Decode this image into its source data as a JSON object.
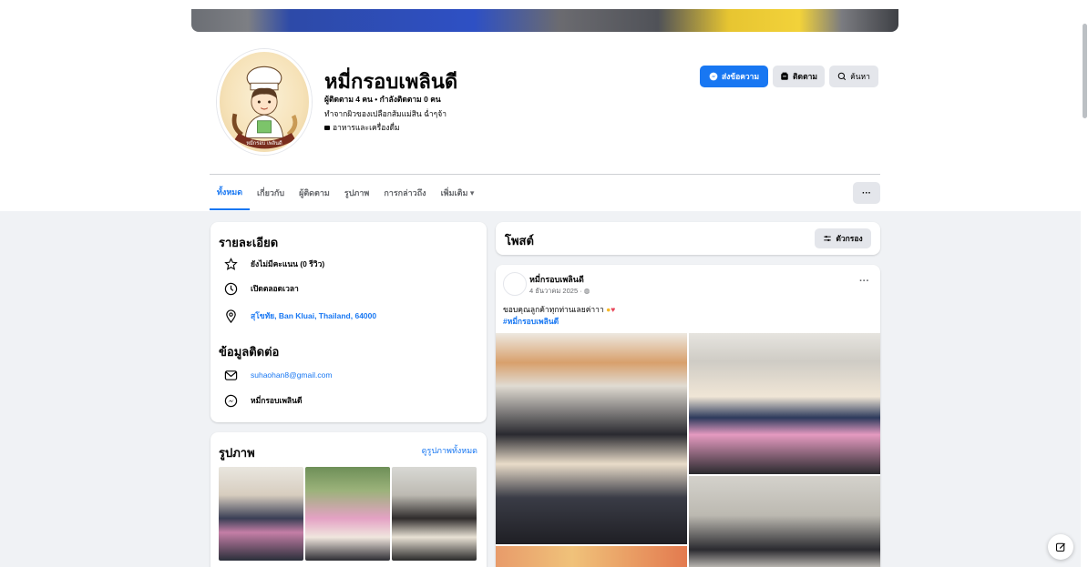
{
  "profile": {
    "name": "หมี่กรอบเพลินดี",
    "followers": "ผู้ติดตาม 4 คน • กำลังติดตาม 0 คน",
    "intro": "ทำจากผิวของเปลือกส้มแม่สิน ฉ่ำๆจ้า",
    "category": "อาหารและเครื่องดื่ม"
  },
  "actions": {
    "message": "ส่งข้อความ",
    "follow": "ติดตาม",
    "search": "ค้นหา"
  },
  "tabs": [
    {
      "label": "ทั้งหมด",
      "active": true
    },
    {
      "label": "เกี่ยวกับ"
    },
    {
      "label": "ผู้ติดตาม"
    },
    {
      "label": "รูปภาพ"
    },
    {
      "label": "การกล่าวถึง"
    },
    {
      "label": "เพิ่มเติม ▾"
    }
  ],
  "tabs_more": "···",
  "details": {
    "heading": "รายละเอียด",
    "rating": "ยังไม่มีคะแนน (0 รีวิว)",
    "hours": "เปิดตลอดเวลา",
    "address_link": "สุโขทัย",
    "address_rest": ", Ban Kluai, Thailand, 64000",
    "contact_heading": "ข้อมูลติดต่อ",
    "email": "suhaohan8@gmail.com",
    "messenger": "หมี่กรอบเพลินดี"
  },
  "photos": {
    "heading": "รูปภาพ",
    "see_all": "ดูรูปภาพทั้งหมด"
  },
  "posts": {
    "heading": "โพสต์",
    "filter": "ตัวกรอง"
  },
  "post": {
    "author": "หมี่กรอบเพลินดี",
    "date": "4 ธันวาคม 2025 · ",
    "more": "···",
    "text": "ขอบคุณลูกค้าทุกท่านเลยค่าาา",
    "hashtag": "#หมี่กรอบเพลินดี"
  },
  "colors": {
    "accent": "#1877f2",
    "background": "#f0f2f5",
    "button_gray": "#e4e6eb"
  },
  "icons": {
    "message": "messenger-icon",
    "follow": "follow-icon",
    "search": "search-icon",
    "rating": "star-icon",
    "hours": "clock-icon",
    "address": "location-pin-icon",
    "email": "mail-icon",
    "messenger": "messenger-icon",
    "filter": "filter-icon",
    "compose": "compose-icon"
  }
}
